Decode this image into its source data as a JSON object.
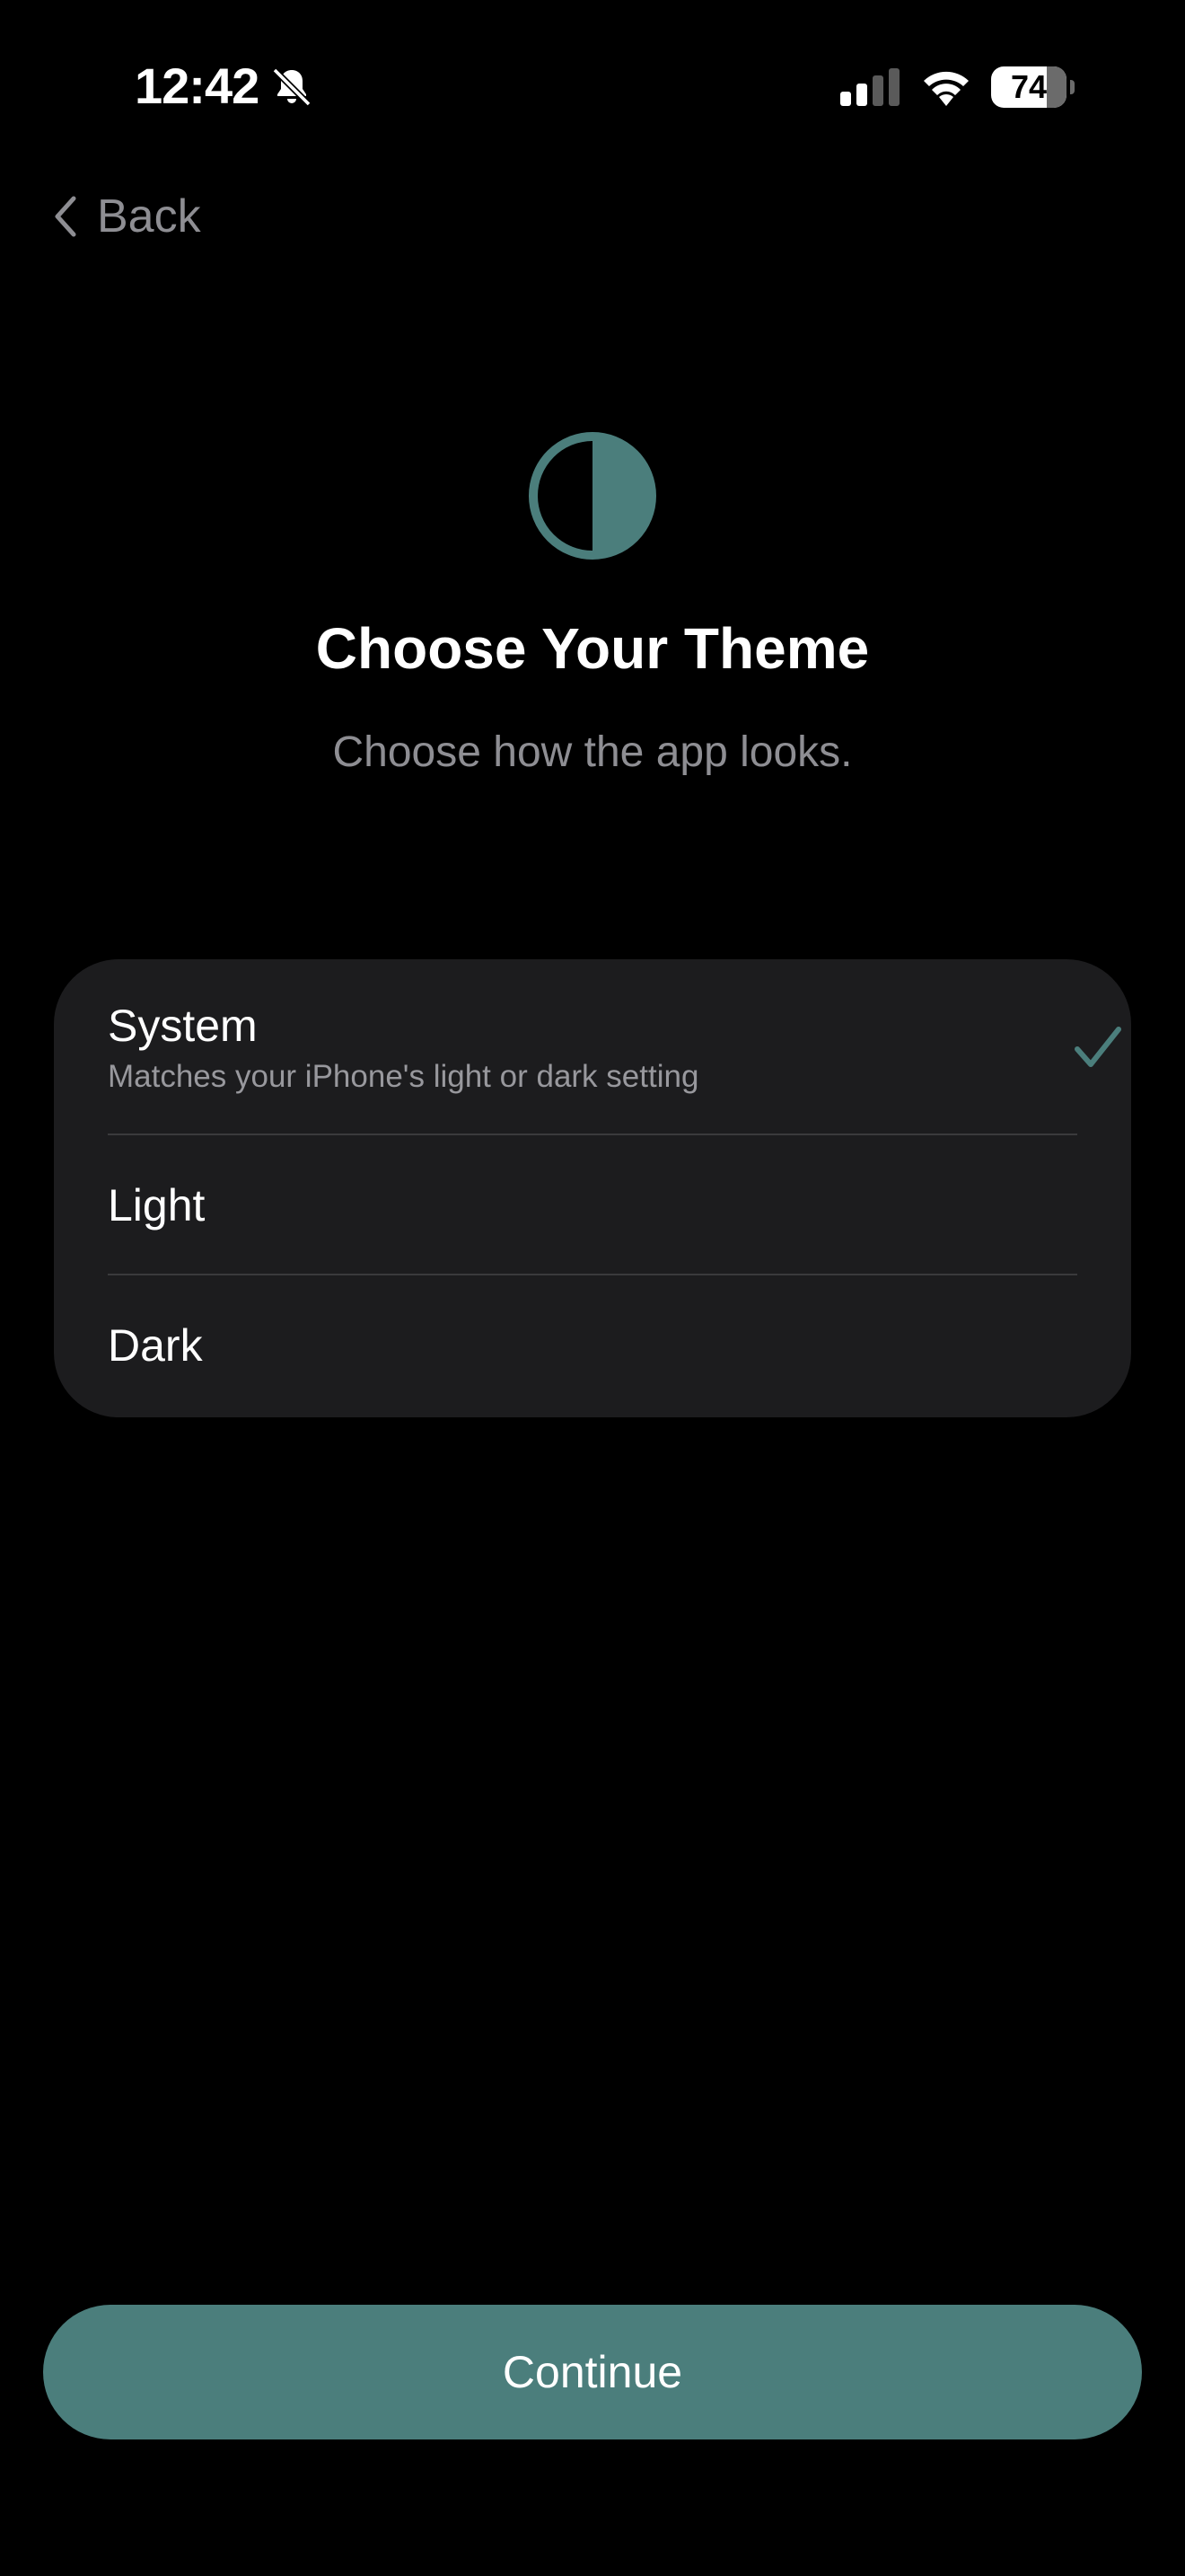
{
  "status_bar": {
    "time": "12:42",
    "battery_level": "74",
    "battery_fraction": 0.74,
    "icons": [
      "bell-slash-icon",
      "cellular-signal-icon",
      "wifi-icon",
      "battery-icon"
    ]
  },
  "nav": {
    "back_label": "Back",
    "back_icon": "chevron-left-icon"
  },
  "header": {
    "icon": "half-circle-theme-icon",
    "title": "Choose Your Theme",
    "subtitle": "Choose how the app looks."
  },
  "theme_options": [
    {
      "label": "System",
      "description": "Matches your iPhone's light or dark setting",
      "selected": true
    },
    {
      "label": "Light",
      "description": "",
      "selected": false
    },
    {
      "label": "Dark",
      "description": "",
      "selected": false
    }
  ],
  "footer": {
    "continue_label": "Continue"
  },
  "colors": {
    "background": "#000000",
    "card": "#1c1c1e",
    "accent": "#4b7e7c",
    "secondary_text": "#8e8e93"
  }
}
